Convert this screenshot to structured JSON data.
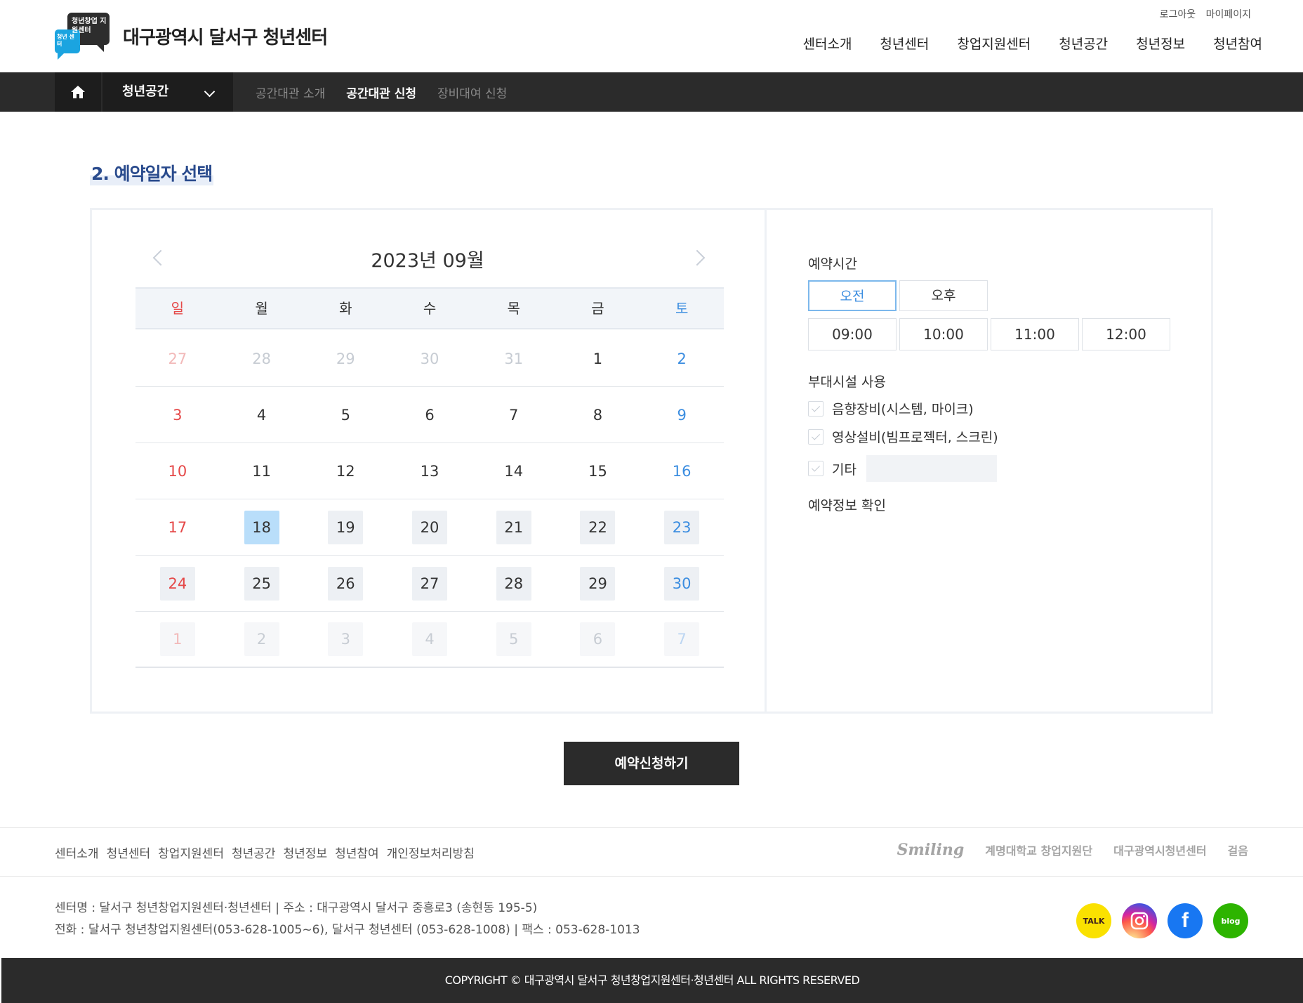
{
  "header": {
    "logo_text_main": "청년창업 지원센터",
    "logo_text_sub": "청년 센터",
    "site_title": "대구광역시 달서구 청년센터",
    "util": [
      "로그아웃",
      "마이페이지"
    ],
    "gnb": [
      "센터소개",
      "청년센터",
      "창업지원센터",
      "청년공간",
      "청년정보",
      "청년참여"
    ]
  },
  "subnav": {
    "category": "청년공간",
    "tabs": [
      {
        "label": "공간대관 소개",
        "active": false
      },
      {
        "label": "공간대관 신청",
        "active": true
      },
      {
        "label": "장비대여 신청",
        "active": false
      }
    ]
  },
  "section_title": "2. 예약일자 선택",
  "calendar": {
    "title": "2023년 09월",
    "weekdays": [
      "일",
      "월",
      "화",
      "수",
      "목",
      "금",
      "토"
    ],
    "weeks": [
      [
        {
          "d": "27",
          "m": 1
        },
        {
          "d": "28",
          "m": 1
        },
        {
          "d": "29",
          "m": 1
        },
        {
          "d": "30",
          "m": 1
        },
        {
          "d": "31",
          "m": 1
        },
        {
          "d": "1"
        },
        {
          "d": "2"
        }
      ],
      [
        {
          "d": "3"
        },
        {
          "d": "4"
        },
        {
          "d": "5"
        },
        {
          "d": "6"
        },
        {
          "d": "7"
        },
        {
          "d": "8"
        },
        {
          "d": "9"
        }
      ],
      [
        {
          "d": "10"
        },
        {
          "d": "11"
        },
        {
          "d": "12"
        },
        {
          "d": "13"
        },
        {
          "d": "14"
        },
        {
          "d": "15"
        },
        {
          "d": "16"
        }
      ],
      [
        {
          "d": "17"
        },
        {
          "d": "18",
          "s": 1
        },
        {
          "d": "19",
          "a": 1
        },
        {
          "d": "20",
          "a": 1
        },
        {
          "d": "21",
          "a": 1
        },
        {
          "d": "22",
          "a": 1
        },
        {
          "d": "23",
          "a": 1
        }
      ],
      [
        {
          "d": "24",
          "a": 1
        },
        {
          "d": "25",
          "a": 1
        },
        {
          "d": "26",
          "a": 1
        },
        {
          "d": "27",
          "a": 1
        },
        {
          "d": "28",
          "a": 1
        },
        {
          "d": "29",
          "a": 1
        },
        {
          "d": "30",
          "a": 1
        }
      ],
      [
        {
          "d": "1",
          "m": 1,
          "a": 1
        },
        {
          "d": "2",
          "m": 1,
          "a": 1
        },
        {
          "d": "3",
          "m": 1,
          "a": 1
        },
        {
          "d": "4",
          "m": 1,
          "a": 1
        },
        {
          "d": "5",
          "m": 1,
          "a": 1
        },
        {
          "d": "6",
          "m": 1,
          "a": 1
        },
        {
          "d": "7",
          "m": 1,
          "a": 1
        }
      ]
    ]
  },
  "form": {
    "time_label": "예약시간",
    "am": "오전",
    "pm": "오후",
    "times": [
      "09:00",
      "10:00",
      "11:00",
      "12:00"
    ],
    "facility_label": "부대시설 사용",
    "options": [
      "음향장비(시스템, 마이크)",
      "영상설비(빔프로젝터, 스크린)",
      "기타"
    ],
    "etc_value": "",
    "confirm_label": "예약정보 확인"
  },
  "submit_label": "예약신청하기",
  "footer": {
    "links": [
      "센터소개",
      "청년센터",
      "창업지원센터",
      "청년공간",
      "청년정보",
      "청년참여",
      "개인정보처리방침"
    ],
    "partners": [
      "Smiling",
      "계명대학교 창업지원단",
      "대구광역시청년센터",
      "걸음"
    ],
    "info_line1": "센터명 : 달서구 청년창업지원센터·청년센터 | 주소 : 대구광역시 달서구 중흥로3 (송현동 195-5)",
    "info_line2": "전화 : 달서구 청년창업지원센터(053-628-1005~6), 달서구 청년센터 (053-628-1008) | 팩스 : 053-628-1013",
    "sns": [
      "TALK",
      "blog"
    ],
    "copyright": "COPYRIGHT © 대구광역시 달서구 청년창업지원센터·청년센터 ALL RIGHTS RESERVED"
  },
  "colors": {
    "accent_title": "#2a4b8d",
    "dark_bar": "#2b2b2b",
    "selected_day": "#b9defa",
    "sunday": "#e54848",
    "saturday": "#3b8de0"
  }
}
